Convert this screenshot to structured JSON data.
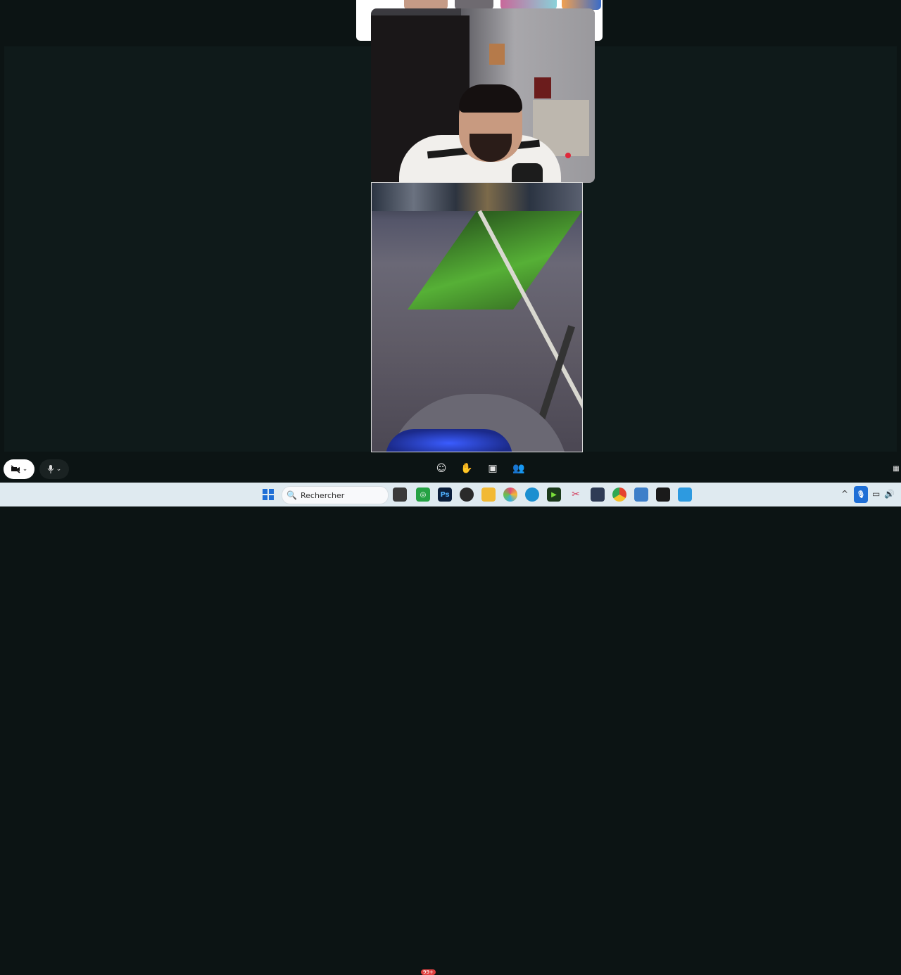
{
  "controls": {
    "camera_icon": "camera-off-icon",
    "mic_icon": "microphone-icon",
    "center_icons": [
      "emoji-icon",
      "raise-hand-icon",
      "share-screen-icon",
      "participants-icon"
    ]
  },
  "taskbar": {
    "search_placeholder": "Rechercher",
    "whatsapp_badge": "99+",
    "apps": [
      {
        "name": "windows-start-icon",
        "color": "#1f6fd6"
      },
      {
        "name": "file-icon",
        "color": "#3a3a3a"
      },
      {
        "name": "whatsapp-icon",
        "color": "#25a244"
      },
      {
        "name": "photoshop-icon",
        "color": "#0b1f3c"
      },
      {
        "name": "obs-icon",
        "color": "#2a2a2a"
      },
      {
        "name": "folder-icon",
        "color": "#f2b934"
      },
      {
        "name": "color-app-icon",
        "color": "#e04c7a"
      },
      {
        "name": "edge-icon",
        "color": "#1b8fd0"
      },
      {
        "name": "terminal-icon",
        "color": "#1b3a1b"
      },
      {
        "name": "snipping-icon",
        "color": "#d23a5a"
      },
      {
        "name": "app-icon",
        "color": "#2e3b55"
      },
      {
        "name": "chrome-icon",
        "color": "#e5432f"
      },
      {
        "name": "notepad-icon",
        "color": "#3d7fc9"
      },
      {
        "name": "capcut-icon",
        "color": "#1a1a1a"
      },
      {
        "name": "paint-icon",
        "color": "#2d9ae0"
      }
    ]
  }
}
